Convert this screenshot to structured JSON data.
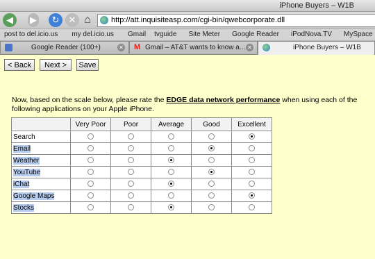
{
  "window": {
    "title": "iPhone Buyers – W1B"
  },
  "address_bar": {
    "url": "http://att.inquisiteasp.com/cgi-bin/qwebcorporate.dll"
  },
  "bookmarks": [
    "post to del.icio.us",
    "my del.icio.us",
    "Gmail",
    "tvguide",
    "Site Meter",
    "Google Reader",
    "iPodNova.TV",
    "MySpace"
  ],
  "tabs": [
    {
      "label": "Google Reader (100+)"
    },
    {
      "label": "Gmail – AT&T wants to know a..."
    },
    {
      "label": "iPhone Buyers – W1B"
    }
  ],
  "form": {
    "back_label": "< Back",
    "next_label": "Next >",
    "save_label": "Save",
    "intro_before": "Now, based on the scale below, please rate the ",
    "intro_emphasis": "EDGE data network performance",
    "intro_after": " when using each of the following applications on your Apple iPhone."
  },
  "scale": [
    "Very Poor",
    "Poor",
    "Average",
    "Good",
    "Excellent"
  ],
  "rows": [
    {
      "label": "Search",
      "selected": "Excellent",
      "highlighted": false
    },
    {
      "label": "Email",
      "selected": "Good",
      "highlighted": true
    },
    {
      "label": "Weather",
      "selected": "Average",
      "highlighted": true
    },
    {
      "label": "YouTube",
      "selected": "Good",
      "highlighted": true
    },
    {
      "label": "iChat",
      "selected": "Average",
      "highlighted": true
    },
    {
      "label": "Google Maps",
      "selected": "Excellent",
      "highlighted": true
    },
    {
      "label": "Stocks",
      "selected": "Average",
      "highlighted": true
    }
  ],
  "colors": {
    "page_background": "#ffffcc",
    "selection_highlight": "#b6cdf0"
  }
}
